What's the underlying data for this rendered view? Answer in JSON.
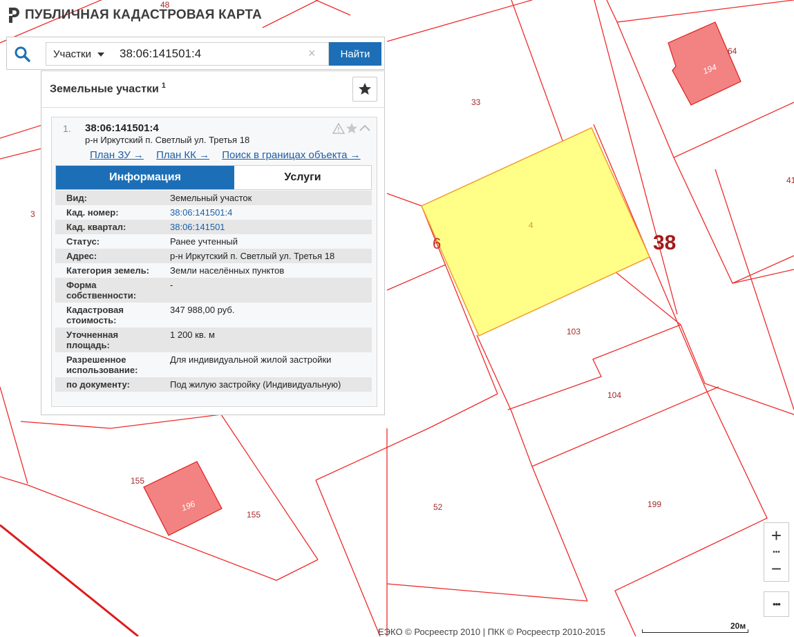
{
  "header": {
    "title": "ПУБЛИЧНАЯ КАДАСТРОВАЯ КАРТА",
    "logo_icon": "pkk-logo-icon"
  },
  "search": {
    "type_label": "Участки",
    "query": "38:06:141501:4",
    "clear_symbol": "×",
    "button_label": "Найти"
  },
  "results": {
    "title": "Земельные участки",
    "count": "1",
    "item": {
      "index": "1.",
      "number": "38:06:141501:4",
      "address": "р-н Иркутский п. Светлый ул. Третья 18",
      "links": [
        "План ЗУ →",
        "План КК →",
        "Поиск в границах объекта →"
      ],
      "tabs": {
        "info": "Информация",
        "services": "Услуги"
      },
      "attributes": [
        {
          "key": "Вид:",
          "value": "Земельный участок"
        },
        {
          "key": "Кад. номер:",
          "value": "38:06:141501:4"
        },
        {
          "key": "Кад. квартал:",
          "value": "38:06:141501"
        },
        {
          "key": "Статус:",
          "value": "Ранее учтенный"
        },
        {
          "key": "Адрес:",
          "value": "р-н Иркутский п. Светлый ул. Третья 18"
        },
        {
          "key": "Категория земель:",
          "value": "Земли населённых пунктов"
        },
        {
          "key": "Форма собственности:",
          "value": "-"
        },
        {
          "key": "Кадастровая стоимость:",
          "value": "347 988,00 руб."
        },
        {
          "key": "Уточненная площадь:",
          "value": "1 200 кв. м"
        },
        {
          "key": "Разрешенное использование:",
          "value": "Для индивидуальной жилой застройки"
        },
        {
          "key": "по документу:",
          "value": "Под жилую застройку (Индивидуальную)"
        }
      ]
    }
  },
  "map": {
    "parcel_labels": [
      "48",
      "33",
      "4",
      "6",
      "38",
      "103",
      "104",
      "52",
      "199",
      "155",
      "155",
      "3",
      "64",
      "41"
    ],
    "building_labels": [
      "194",
      "196"
    ],
    "selected_parcel": "4",
    "colors": {
      "boundary": "#ee2a2a",
      "selected_fill": "#ffff88",
      "building_fill": "#f38282",
      "label": "#a52a2a",
      "road_line": "#dd1c1c"
    }
  },
  "controls": {
    "zoom_in": "+",
    "zoom_out": "−",
    "zoom_dots": "•••",
    "more": "•••"
  },
  "footer": {
    "copyright": "ЕЭКО © Росреестр 2010 | ПКК © Росреестр 2010-2015",
    "scale": "20м"
  },
  "theme": {
    "accent": "#1c6fb6",
    "link": "#1c5fa6"
  }
}
